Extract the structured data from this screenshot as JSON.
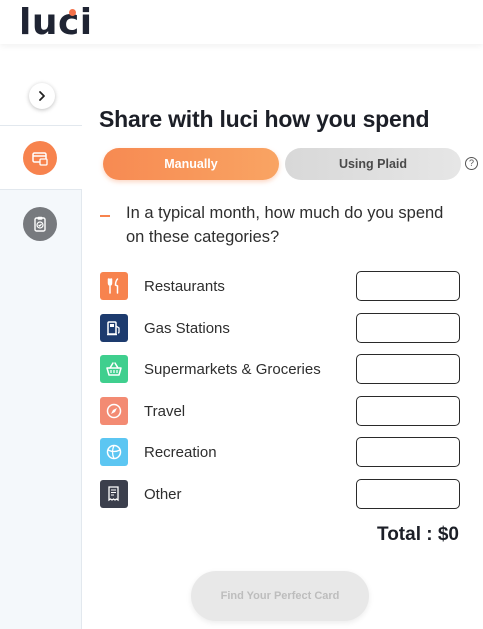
{
  "app": {
    "logo": "luci"
  },
  "title": "Share with luci how you spend",
  "mode_toggle": {
    "manual_label": "Manually",
    "plaid_label": "Using Plaid",
    "selected": "Manually",
    "help": "?"
  },
  "question": "In a typical month, how much do you spend on these categories?",
  "categories": [
    {
      "label": "Restaurants",
      "icon": "fork-knife-icon",
      "color": "#f7834e",
      "value": ""
    },
    {
      "label": "Gas Stations",
      "icon": "gas-pump-icon",
      "color": "#1d3b6e",
      "value": ""
    },
    {
      "label": "Supermarkets & Groceries",
      "icon": "basket-icon",
      "color": "#3fcf8e",
      "value": ""
    },
    {
      "label": "Travel",
      "icon": "compass-icon",
      "color": "#f38b73",
      "value": ""
    },
    {
      "label": "Recreation",
      "icon": "ball-icon",
      "color": "#5cc6f2",
      "value": ""
    },
    {
      "label": "Other",
      "icon": "receipt-icon",
      "color": "#3b3f4c",
      "value": ""
    }
  ],
  "total": "Total : $0",
  "cta": {
    "label": "Find Your Perfect Card",
    "enabled": false
  },
  "sidebar": {
    "items": [
      "expand",
      "card-recommendation",
      "checklist"
    ]
  }
}
